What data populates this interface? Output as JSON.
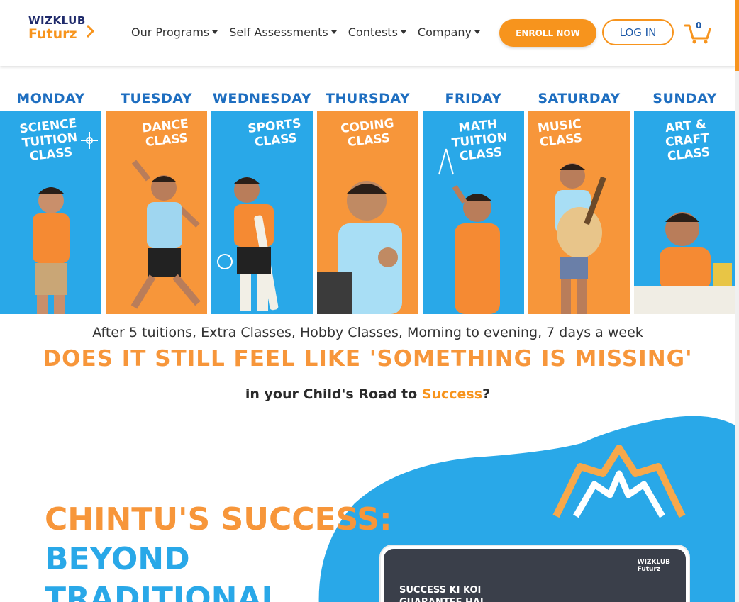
{
  "header": {
    "logo_line1": "WIZKLUB",
    "logo_line2": "Futurz",
    "nav": [
      {
        "label": "Our Programs"
      },
      {
        "label": "Self Assessments"
      },
      {
        "label": "Contests"
      },
      {
        "label": "Company"
      }
    ],
    "enroll_label": "ENROLL NOW",
    "login_label": "LOG IN",
    "cart_count": "0"
  },
  "week": [
    {
      "day": "MONDAY",
      "class": "SCIENCE TUITION CLASS",
      "color": "#29a8e8"
    },
    {
      "day": "TUESDAY",
      "class": "DANCE CLASS",
      "color": "#f7963a"
    },
    {
      "day": "WEDNESDAY",
      "class": "SPORTS CLASS",
      "color": "#29a8e8"
    },
    {
      "day": "THURSDAY",
      "class": "CODING CLASS",
      "color": "#f7963a"
    },
    {
      "day": "FRIDAY",
      "class": "MATH TUITION CLASS",
      "color": "#29a8e8"
    },
    {
      "day": "SATURDAY",
      "class": "MUSIC CLASS",
      "color": "#f7963a"
    },
    {
      "day": "SUNDAY",
      "class": "ART & CRAFT CLASS",
      "color": "#29a8e8"
    }
  ],
  "tagline": "After 5 tuitions, Extra Classes, Hobby Classes, Morning to evening, 7 days a week",
  "missing": "DOES IT STILL FEEL LIKE 'SOMETHING IS MISSING'",
  "road_prefix": "in your Child's Road to ",
  "road_highlight": "Success",
  "road_suffix": "?",
  "chintu": {
    "line1": "CHINTU'S SUCCESS:",
    "line2": "BEYOND",
    "line3": "TRADITIONAL"
  },
  "video": {
    "text_line1": "SUCCESS KI KOI",
    "text_line2": "GUARANTEE HAI",
    "logo_line1": "WIZKLUB",
    "logo_line2": "Futurz"
  },
  "colors": {
    "orange": "#f7963a",
    "blue": "#29a8e8",
    "navy": "#1e6ec0"
  }
}
